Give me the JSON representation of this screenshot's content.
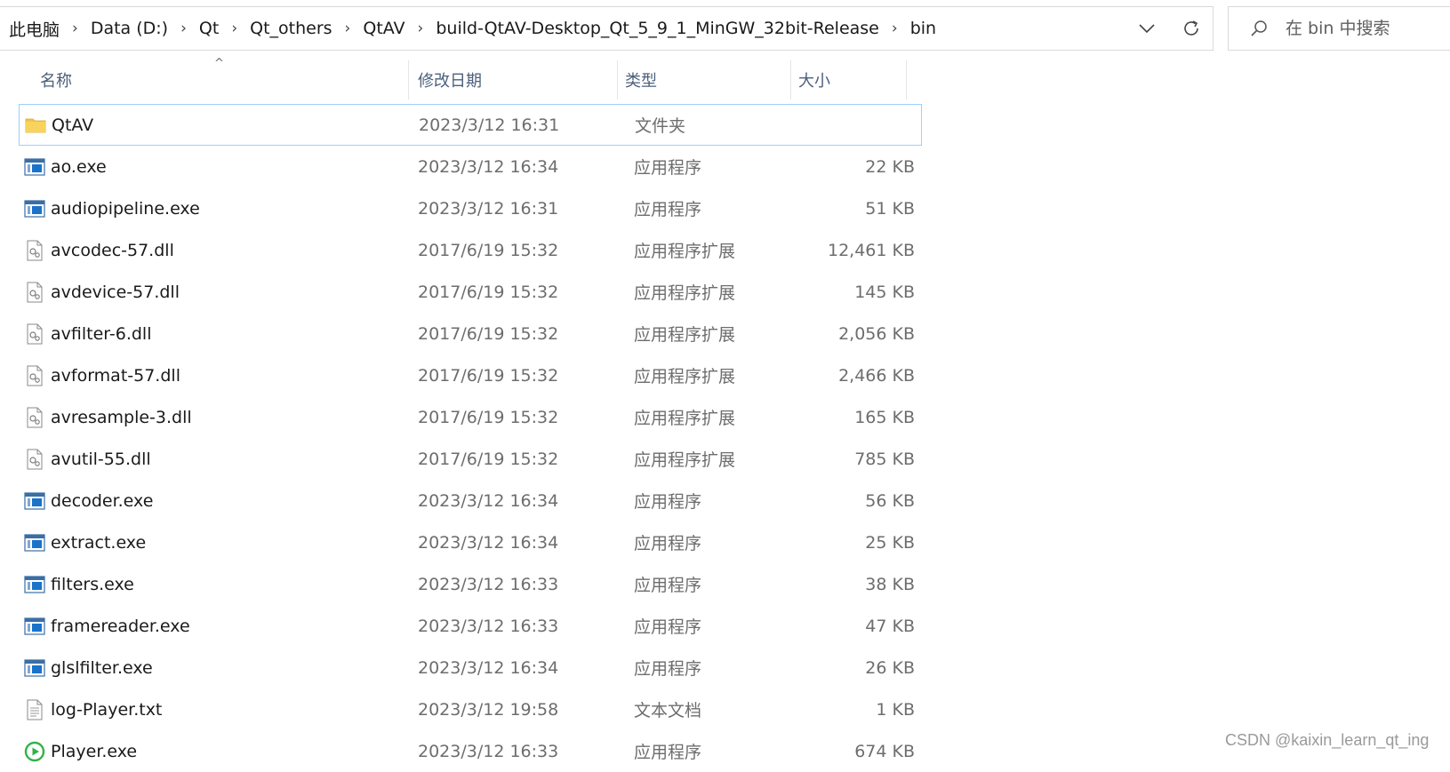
{
  "address": {
    "crumbs": [
      "此电脑",
      "Data (D:)",
      "Qt",
      "Qt_others",
      "QtAV",
      "build-QtAV-Desktop_Qt_5_9_1_MinGW_32bit-Release",
      "bin"
    ],
    "separator": "›"
  },
  "search": {
    "placeholder": "在 bin 中搜索"
  },
  "columns": {
    "name": "名称",
    "date": "修改日期",
    "type": "类型",
    "size": "大小"
  },
  "files": [
    {
      "icon": "folder-icon",
      "name": "QtAV",
      "date": "2023/3/12 16:31",
      "type": "文件夹",
      "size": ""
    },
    {
      "icon": "exe-icon",
      "name": "ao.exe",
      "date": "2023/3/12 16:34",
      "type": "应用程序",
      "size": "22 KB"
    },
    {
      "icon": "exe-icon",
      "name": "audiopipeline.exe",
      "date": "2023/3/12 16:31",
      "type": "应用程序",
      "size": "51 KB"
    },
    {
      "icon": "dll-icon",
      "name": "avcodec-57.dll",
      "date": "2017/6/19 15:32",
      "type": "应用程序扩展",
      "size": "12,461 KB"
    },
    {
      "icon": "dll-icon",
      "name": "avdevice-57.dll",
      "date": "2017/6/19 15:32",
      "type": "应用程序扩展",
      "size": "145 KB"
    },
    {
      "icon": "dll-icon",
      "name": "avfilter-6.dll",
      "date": "2017/6/19 15:32",
      "type": "应用程序扩展",
      "size": "2,056 KB"
    },
    {
      "icon": "dll-icon",
      "name": "avformat-57.dll",
      "date": "2017/6/19 15:32",
      "type": "应用程序扩展",
      "size": "2,466 KB"
    },
    {
      "icon": "dll-icon",
      "name": "avresample-3.dll",
      "date": "2017/6/19 15:32",
      "type": "应用程序扩展",
      "size": "165 KB"
    },
    {
      "icon": "dll-icon",
      "name": "avutil-55.dll",
      "date": "2017/6/19 15:32",
      "type": "应用程序扩展",
      "size": "785 KB"
    },
    {
      "icon": "exe-icon",
      "name": "decoder.exe",
      "date": "2023/3/12 16:34",
      "type": "应用程序",
      "size": "56 KB"
    },
    {
      "icon": "exe-icon",
      "name": "extract.exe",
      "date": "2023/3/12 16:34",
      "type": "应用程序",
      "size": "25 KB"
    },
    {
      "icon": "exe-icon",
      "name": "filters.exe",
      "date": "2023/3/12 16:33",
      "type": "应用程序",
      "size": "38 KB"
    },
    {
      "icon": "exe-icon",
      "name": "framereader.exe",
      "date": "2023/3/12 16:33",
      "type": "应用程序",
      "size": "47 KB"
    },
    {
      "icon": "exe-icon",
      "name": "glslfilter.exe",
      "date": "2023/3/12 16:34",
      "type": "应用程序",
      "size": "26 KB"
    },
    {
      "icon": "txt-icon",
      "name": "log-Player.txt",
      "date": "2023/3/12 19:58",
      "type": "文本文档",
      "size": "1 KB"
    },
    {
      "icon": "player-icon",
      "name": "Player.exe",
      "date": "2023/3/12 16:33",
      "type": "应用程序",
      "size": "674 KB"
    }
  ],
  "watermark": "CSDN @kaixin_learn_qt_ing",
  "colors": {
    "selection_border": "#99d1ff",
    "header_text": "#4c607a",
    "folder": "#f4c542",
    "exe": "#1a73c9",
    "player": "#2fb34a"
  }
}
